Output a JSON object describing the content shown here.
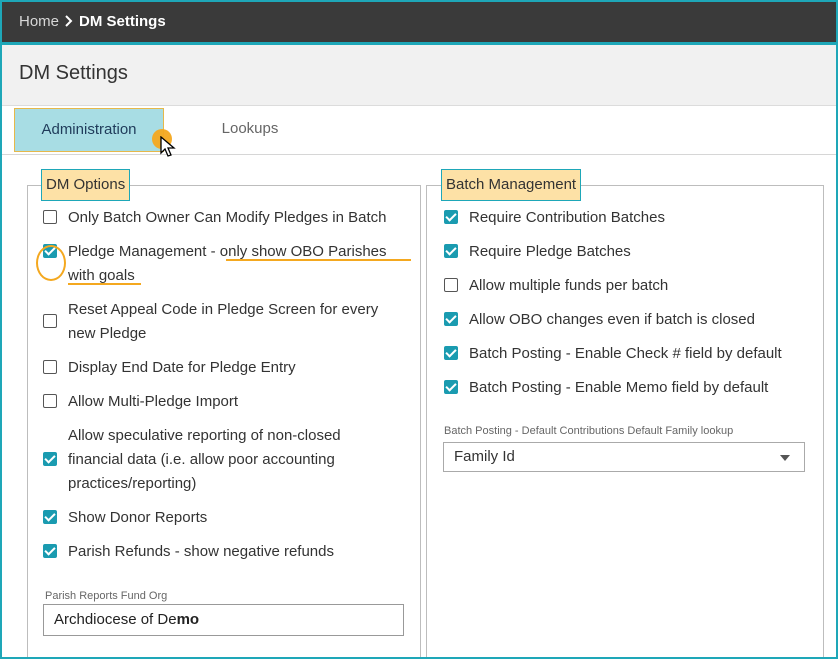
{
  "breadcrumb": {
    "home": "Home",
    "current": "DM Settings"
  },
  "page": {
    "title": "DM Settings"
  },
  "tabs": [
    {
      "label": "Administration",
      "active": true
    },
    {
      "label": "Lookups",
      "active": false
    }
  ],
  "dm_options": {
    "legend": "DM Options",
    "items": [
      {
        "label": "Only Batch Owner Can Modify Pledges in Batch",
        "checked": false
      },
      {
        "label_pre": "Pledge Management - ",
        "label_hl1": "only show OBO Parishes",
        "label_hl2": "with goals",
        "checked": true
      },
      {
        "label_l1": "Reset Appeal Code in Pledge Screen for every",
        "label_l2": "new Pledge",
        "checked": false
      },
      {
        "label": "Display End Date for Pledge Entry",
        "checked": false
      },
      {
        "label": "Allow Multi-Pledge Import",
        "checked": false
      },
      {
        "label_l1": "Allow speculative reporting of non-closed",
        "label_l2": "financial data (i.e. allow poor accounting",
        "label_l3": "practices/reporting)",
        "checked": true
      },
      {
        "label": "Show Donor Reports",
        "checked": true
      },
      {
        "label": "Parish Refunds - show negative refunds",
        "checked": true
      }
    ],
    "fund_org": {
      "label": "Parish Reports Fund Org",
      "value_a": "Archdiocese of De",
      "value_b": "mo"
    }
  },
  "batch_management": {
    "legend": "Batch Management",
    "items": [
      {
        "label": "Require Contribution Batches",
        "checked": true
      },
      {
        "label": "Require Pledge Batches",
        "checked": true
      },
      {
        "label": "Allow multiple funds per batch",
        "checked": false
      },
      {
        "label": "Allow OBO changes even if batch is closed",
        "checked": true
      },
      {
        "label": "Batch Posting - Enable Check # field by default",
        "checked": true
      },
      {
        "label": "Batch Posting - Enable Memo field by default",
        "checked": true
      }
    ],
    "family_lookup": {
      "label": "Batch Posting - Default Contributions Default Family lookup",
      "value": "Family Id"
    }
  },
  "colors": {
    "accent": "#1ea7b8",
    "check": "#1a9bb0",
    "highlight": "#f4a81f",
    "topbar": "#3a3a3a"
  }
}
